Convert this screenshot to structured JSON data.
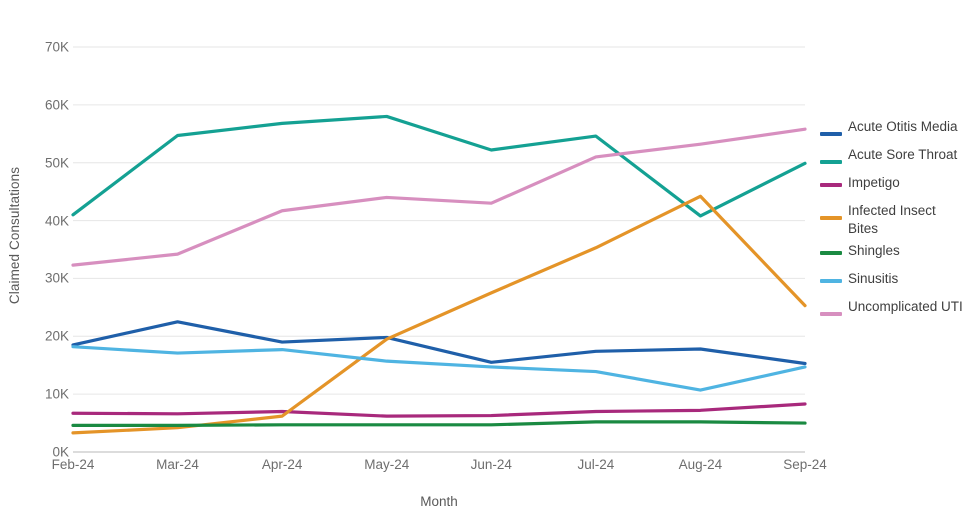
{
  "chart_data": {
    "type": "line",
    "title": "",
    "xlabel": "Month",
    "ylabel": "Claimed Consultations",
    "categories": [
      "Feb-24",
      "Mar-24",
      "Apr-24",
      "May-24",
      "Jun-24",
      "Jul-24",
      "Aug-24",
      "Sep-24"
    ],
    "ylim": [
      0,
      70000
    ],
    "ytick_values": [
      0,
      10000,
      20000,
      30000,
      40000,
      50000,
      60000,
      70000
    ],
    "ytick_labels": [
      "0K",
      "10K",
      "20K",
      "30K",
      "40K",
      "50K",
      "60K",
      "70K"
    ],
    "grid": "horizontal",
    "legend_position": "right",
    "series": [
      {
        "name": "Acute Otitis Media",
        "color": "#1f5fa9",
        "values": [
          18500,
          22500,
          19000,
          19800,
          15500,
          17400,
          17800,
          15300
        ]
      },
      {
        "name": "Acute Sore Throat",
        "color": "#14a193",
        "values": [
          41000,
          54700,
          56800,
          58000,
          52200,
          54600,
          40800,
          49900
        ]
      },
      {
        "name": "Impetigo",
        "color": "#a8297c",
        "values": [
          6700,
          6600,
          7000,
          6200,
          6300,
          7000,
          7200,
          8300
        ]
      },
      {
        "name": "Infected Insect Bites",
        "color": "#e49428",
        "values": [
          3300,
          4200,
          6200,
          19500,
          27500,
          35300,
          44200,
          25300
        ]
      },
      {
        "name": "Shingles",
        "color": "#1a8a42",
        "values": [
          4600,
          4600,
          4700,
          4700,
          4700,
          5200,
          5200,
          5000
        ]
      },
      {
        "name": "Sinusitis",
        "color": "#4fb4e2",
        "values": [
          18200,
          17100,
          17700,
          15700,
          14700,
          13900,
          10700,
          14700
        ]
      },
      {
        "name": "Uncomplicated UTI",
        "color": "#d78fbf",
        "values": [
          32300,
          34200,
          41700,
          44000,
          43000,
          51000,
          53200,
          55800
        ]
      }
    ]
  },
  "legend": {
    "items": [
      {
        "label": "Acute Otitis Media"
      },
      {
        "label": "Acute Sore Throat"
      },
      {
        "label": "Impetigo"
      },
      {
        "label": "Infected Insect Bites"
      },
      {
        "label": "Shingles"
      },
      {
        "label": "Sinusitis"
      },
      {
        "label": "Uncomplicated UTI"
      }
    ]
  },
  "axes": {
    "y_title": "Claimed Consultations",
    "x_title": "Month"
  },
  "colors": {
    "grid": "#e6e6e6",
    "axis_text": "#6e6e6e",
    "legend_text": "#3f3f3f",
    "background": "#ffffff"
  }
}
